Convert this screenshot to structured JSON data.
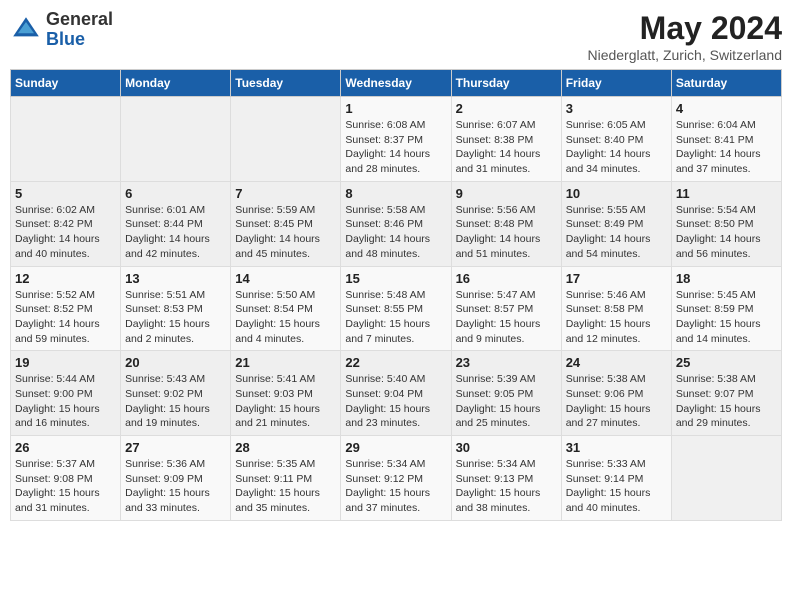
{
  "logo": {
    "general": "General",
    "blue": "Blue"
  },
  "title": "May 2024",
  "location": "Niederglatt, Zurich, Switzerland",
  "days_of_week": [
    "Sunday",
    "Monday",
    "Tuesday",
    "Wednesday",
    "Thursday",
    "Friday",
    "Saturday"
  ],
  "weeks": [
    [
      {
        "day": "",
        "info": ""
      },
      {
        "day": "",
        "info": ""
      },
      {
        "day": "",
        "info": ""
      },
      {
        "day": "1",
        "info": "Sunrise: 6:08 AM\nSunset: 8:37 PM\nDaylight: 14 hours\nand 28 minutes."
      },
      {
        "day": "2",
        "info": "Sunrise: 6:07 AM\nSunset: 8:38 PM\nDaylight: 14 hours\nand 31 minutes."
      },
      {
        "day": "3",
        "info": "Sunrise: 6:05 AM\nSunset: 8:40 PM\nDaylight: 14 hours\nand 34 minutes."
      },
      {
        "day": "4",
        "info": "Sunrise: 6:04 AM\nSunset: 8:41 PM\nDaylight: 14 hours\nand 37 minutes."
      }
    ],
    [
      {
        "day": "5",
        "info": "Sunrise: 6:02 AM\nSunset: 8:42 PM\nDaylight: 14 hours\nand 40 minutes."
      },
      {
        "day": "6",
        "info": "Sunrise: 6:01 AM\nSunset: 8:44 PM\nDaylight: 14 hours\nand 42 minutes."
      },
      {
        "day": "7",
        "info": "Sunrise: 5:59 AM\nSunset: 8:45 PM\nDaylight: 14 hours\nand 45 minutes."
      },
      {
        "day": "8",
        "info": "Sunrise: 5:58 AM\nSunset: 8:46 PM\nDaylight: 14 hours\nand 48 minutes."
      },
      {
        "day": "9",
        "info": "Sunrise: 5:56 AM\nSunset: 8:48 PM\nDaylight: 14 hours\nand 51 minutes."
      },
      {
        "day": "10",
        "info": "Sunrise: 5:55 AM\nSunset: 8:49 PM\nDaylight: 14 hours\nand 54 minutes."
      },
      {
        "day": "11",
        "info": "Sunrise: 5:54 AM\nSunset: 8:50 PM\nDaylight: 14 hours\nand 56 minutes."
      }
    ],
    [
      {
        "day": "12",
        "info": "Sunrise: 5:52 AM\nSunset: 8:52 PM\nDaylight: 14 hours\nand 59 minutes."
      },
      {
        "day": "13",
        "info": "Sunrise: 5:51 AM\nSunset: 8:53 PM\nDaylight: 15 hours\nand 2 minutes."
      },
      {
        "day": "14",
        "info": "Sunrise: 5:50 AM\nSunset: 8:54 PM\nDaylight: 15 hours\nand 4 minutes."
      },
      {
        "day": "15",
        "info": "Sunrise: 5:48 AM\nSunset: 8:55 PM\nDaylight: 15 hours\nand 7 minutes."
      },
      {
        "day": "16",
        "info": "Sunrise: 5:47 AM\nSunset: 8:57 PM\nDaylight: 15 hours\nand 9 minutes."
      },
      {
        "day": "17",
        "info": "Sunrise: 5:46 AM\nSunset: 8:58 PM\nDaylight: 15 hours\nand 12 minutes."
      },
      {
        "day": "18",
        "info": "Sunrise: 5:45 AM\nSunset: 8:59 PM\nDaylight: 15 hours\nand 14 minutes."
      }
    ],
    [
      {
        "day": "19",
        "info": "Sunrise: 5:44 AM\nSunset: 9:00 PM\nDaylight: 15 hours\nand 16 minutes."
      },
      {
        "day": "20",
        "info": "Sunrise: 5:43 AM\nSunset: 9:02 PM\nDaylight: 15 hours\nand 19 minutes."
      },
      {
        "day": "21",
        "info": "Sunrise: 5:41 AM\nSunset: 9:03 PM\nDaylight: 15 hours\nand 21 minutes."
      },
      {
        "day": "22",
        "info": "Sunrise: 5:40 AM\nSunset: 9:04 PM\nDaylight: 15 hours\nand 23 minutes."
      },
      {
        "day": "23",
        "info": "Sunrise: 5:39 AM\nSunset: 9:05 PM\nDaylight: 15 hours\nand 25 minutes."
      },
      {
        "day": "24",
        "info": "Sunrise: 5:38 AM\nSunset: 9:06 PM\nDaylight: 15 hours\nand 27 minutes."
      },
      {
        "day": "25",
        "info": "Sunrise: 5:38 AM\nSunset: 9:07 PM\nDaylight: 15 hours\nand 29 minutes."
      }
    ],
    [
      {
        "day": "26",
        "info": "Sunrise: 5:37 AM\nSunset: 9:08 PM\nDaylight: 15 hours\nand 31 minutes."
      },
      {
        "day": "27",
        "info": "Sunrise: 5:36 AM\nSunset: 9:09 PM\nDaylight: 15 hours\nand 33 minutes."
      },
      {
        "day": "28",
        "info": "Sunrise: 5:35 AM\nSunset: 9:11 PM\nDaylight: 15 hours\nand 35 minutes."
      },
      {
        "day": "29",
        "info": "Sunrise: 5:34 AM\nSunset: 9:12 PM\nDaylight: 15 hours\nand 37 minutes."
      },
      {
        "day": "30",
        "info": "Sunrise: 5:34 AM\nSunset: 9:13 PM\nDaylight: 15 hours\nand 38 minutes."
      },
      {
        "day": "31",
        "info": "Sunrise: 5:33 AM\nSunset: 9:14 PM\nDaylight: 15 hours\nand 40 minutes."
      },
      {
        "day": "",
        "info": ""
      }
    ]
  ]
}
